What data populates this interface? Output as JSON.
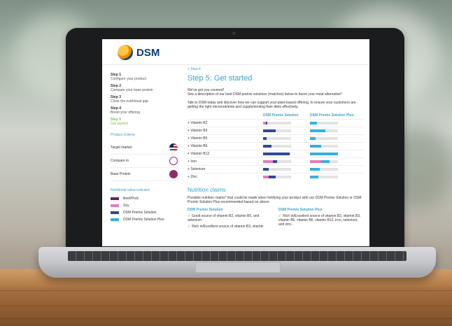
{
  "app": {
    "logo_text": "DSM"
  },
  "steps": [
    {
      "num": "Step 1",
      "label": "Configure your product",
      "active": false
    },
    {
      "num": "Step 2",
      "label": "Compare your base protein",
      "active": false
    },
    {
      "num": "Step 3",
      "label": "Close the nutritional gap",
      "active": false
    },
    {
      "num": "Step 4",
      "label": "Boost your offering",
      "active": false
    },
    {
      "num": "Step 5",
      "label": "Get started",
      "active": true
    }
  ],
  "criteria": {
    "heading": "Product Criteria",
    "items": [
      {
        "label": "Target market",
        "icon": "us-flag-icon"
      },
      {
        "label": "Compare to",
        "icon": "animal-icon"
      },
      {
        "label": "Base Protein",
        "icon": "protein-icon"
      }
    ]
  },
  "legend": {
    "heading": "Nutritional value indicator",
    "items": [
      {
        "label": "Beef/Pork",
        "color": "#6b2060"
      },
      {
        "label": "Soy",
        "color": "#e57bc0"
      },
      {
        "label": "DSM Premix Solution",
        "color": "#2b4a9a"
      },
      {
        "label": "DSM Premix Solution Plus",
        "color": "#33b0e0"
      }
    ]
  },
  "main": {
    "back": "< Step 4",
    "title": "Step 5: Get started",
    "p1": "We've got you covered!",
    "p2": "See a description of our best DSM premix solutions (matches) below to boost your meat alternative*.",
    "p3": "Talk to DSM today and discover how we can support your plant-based offering, to ensure your customers are getting the right micronutrients and supplementing their diets effectively.",
    "col1": "DSM Premix Solution",
    "col2": "DSM Premix Solution Plus",
    "vitamins": [
      {
        "label": "Vitamin B2",
        "s1": [
          {
            "k": "b",
            "v": 0.1
          },
          {
            "k": "a",
            "v": 0.05
          }
        ],
        "s2": [
          {
            "k": "c",
            "v": 0.25
          }
        ]
      },
      {
        "label": "Vitamin B3",
        "s1": [
          {
            "k": "a",
            "v": 0.45
          }
        ],
        "s2": [
          {
            "k": "c",
            "v": 0.55
          }
        ]
      },
      {
        "label": "Vitamin B5",
        "s1": [
          {
            "k": "a",
            "v": 0.12
          }
        ],
        "s2": [
          {
            "k": "c",
            "v": 0.2
          }
        ]
      },
      {
        "label": "Vitamin B6",
        "s1": [
          {
            "k": "a",
            "v": 0.3
          }
        ],
        "s2": [
          {
            "k": "c",
            "v": 0.4
          }
        ]
      },
      {
        "label": "Vitamin B12",
        "s1": [
          {
            "k": "a",
            "v": 0.95
          }
        ],
        "s2": [
          {
            "k": "c",
            "v": 1.0
          }
        ]
      },
      {
        "label": "Iron",
        "s1": [
          {
            "k": "b",
            "v": 0.35
          },
          {
            "k": "a",
            "v": 0.15
          }
        ],
        "s2": [
          {
            "k": "b",
            "v": 0.4
          },
          {
            "k": "c",
            "v": 0.3
          }
        ]
      },
      {
        "label": "Selenium",
        "s1": [
          {
            "k": "a",
            "v": 0.2
          }
        ],
        "s2": [
          {
            "k": "c",
            "v": 0.35
          }
        ]
      },
      {
        "label": "Zinc",
        "s1": [
          {
            "k": "b",
            "v": 0.2
          },
          {
            "k": "a",
            "v": 0.25
          }
        ],
        "s2": [
          {
            "k": "c",
            "v": 0.3
          }
        ]
      }
    ],
    "claims_title": "Nutrition claims",
    "claims_intro": "Possible nutrition claims* that could be made when fortifying your product with our DSM Premix Solution or DSM Premix Solution Plus recommended based on above:",
    "claim1_title": "DSM Premix Solution",
    "claim1_text": "Good source of vitamin B2, vitamin B5, and selenium.",
    "claim1_text2": "Rich in/Excellent source of vitamin B3, vitamin",
    "claim2_title": "DSM Premix Solution Plus",
    "claim2_text": "Rich in/Excellent source of vitamin B2, vitamin B3, vitamin B5, vitamin B6, vitamin B12, iron, selenium, and zinc."
  }
}
